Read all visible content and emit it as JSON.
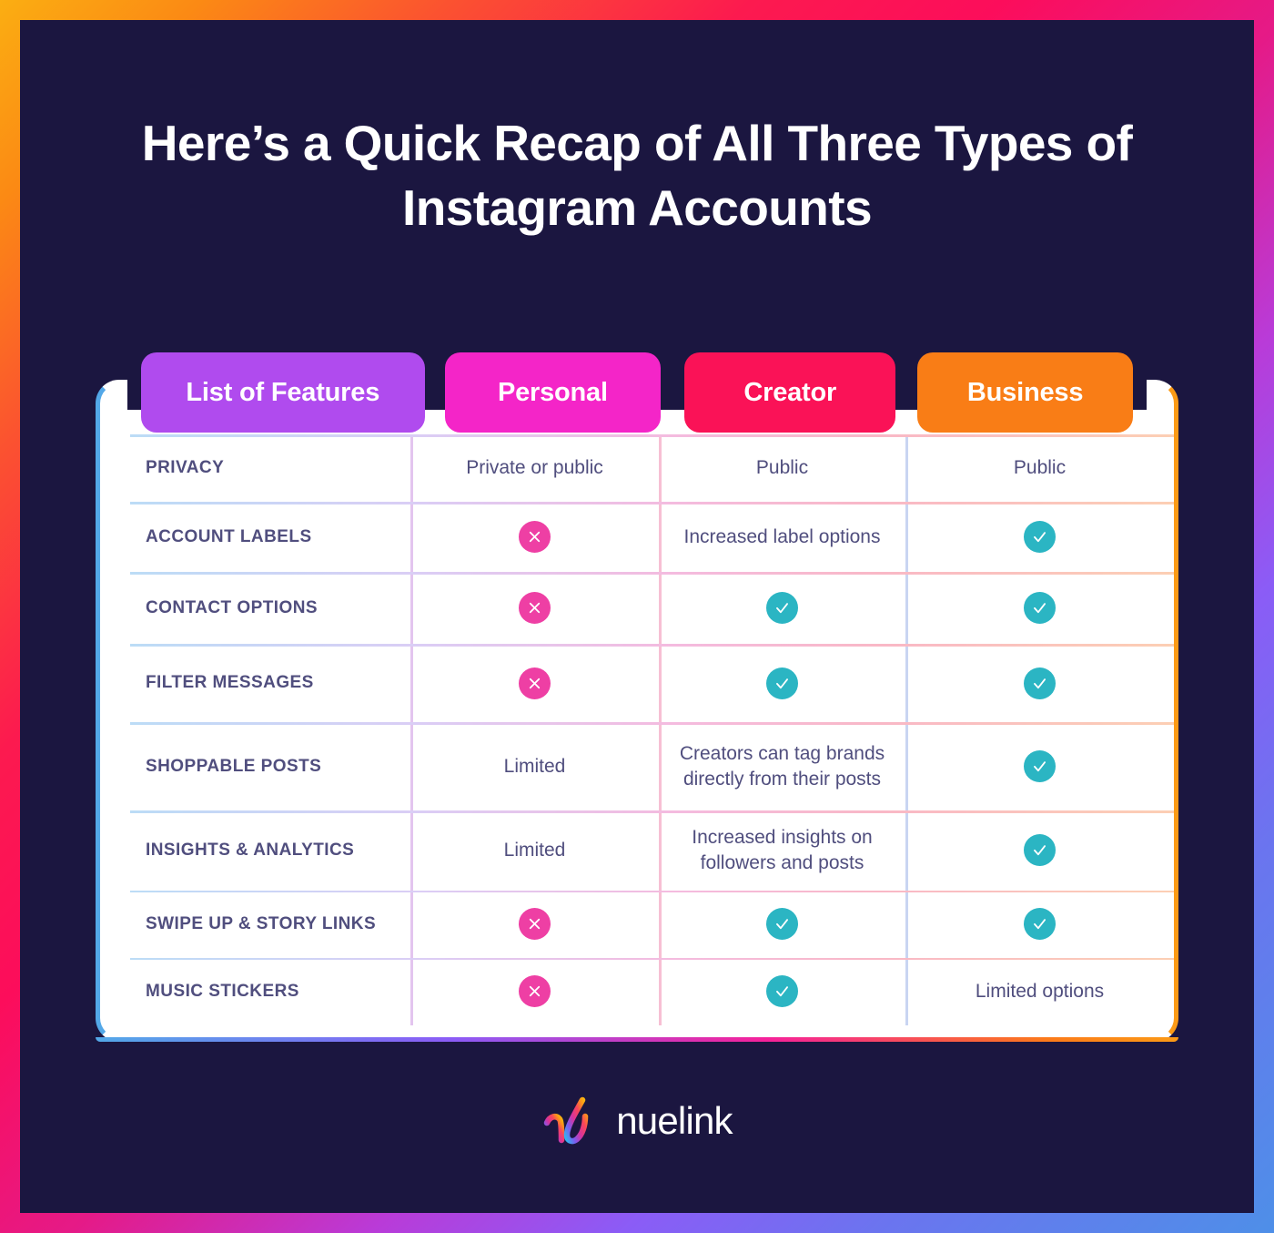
{
  "title": "Here’s a Quick Recap of All Three Types of Instagram Accounts",
  "brand": {
    "wordmark": "nuelink",
    "colors": {
      "background": "#1b1640",
      "frame_start": "#fbae12",
      "frame_mid": "#fc0d5b",
      "frame_end": "#4e8fe8",
      "cross": "#ee3fa4",
      "check": "#2bb5c3",
      "text": "#504e7e"
    }
  },
  "table": {
    "columns": [
      {
        "label": "List of Features",
        "color": "#b04bee"
      },
      {
        "label": "Personal",
        "color": "#f425c8"
      },
      {
        "label": "Creator",
        "color": "#fa1257"
      },
      {
        "label": "Business",
        "color": "#f97d16"
      }
    ],
    "rows": [
      {
        "feature": "PRIVACY",
        "personal": {
          "type": "text",
          "value": "Private or public"
        },
        "creator": {
          "type": "text",
          "value": "Public"
        },
        "business": {
          "type": "text",
          "value": "Public"
        }
      },
      {
        "feature": "ACCOUNT LABELS",
        "personal": {
          "type": "cross",
          "value": "Not available"
        },
        "creator": {
          "type": "text",
          "value": "Increased label options"
        },
        "business": {
          "type": "check",
          "value": "Available"
        }
      },
      {
        "feature": "CONTACT OPTIONS",
        "personal": {
          "type": "cross",
          "value": "Not available"
        },
        "creator": {
          "type": "check",
          "value": "Available"
        },
        "business": {
          "type": "check",
          "value": "Available"
        }
      },
      {
        "feature": "FILTER MESSAGES",
        "personal": {
          "type": "cross",
          "value": "Not available"
        },
        "creator": {
          "type": "check",
          "value": "Available"
        },
        "business": {
          "type": "check",
          "value": "Available"
        }
      },
      {
        "feature": "SHOPPABLE POSTS",
        "personal": {
          "type": "text",
          "value": "Limited"
        },
        "creator": {
          "type": "text",
          "value": "Creators can tag brands directly from their posts"
        },
        "business": {
          "type": "check",
          "value": "Available"
        }
      },
      {
        "feature": "INSIGHTS & ANALYTICS",
        "personal": {
          "type": "text",
          "value": "Limited"
        },
        "creator": {
          "type": "text",
          "value": "Increased insights on followers and posts"
        },
        "business": {
          "type": "check",
          "value": "Available"
        }
      },
      {
        "feature": "SWIPE UP & STORY LINKS",
        "personal": {
          "type": "cross",
          "value": "Not available"
        },
        "creator": {
          "type": "check",
          "value": "Available"
        },
        "business": {
          "type": "check",
          "value": "Available"
        }
      },
      {
        "feature": "MUSIC STICKERS",
        "personal": {
          "type": "cross",
          "value": "Not available"
        },
        "creator": {
          "type": "check",
          "value": "Available"
        },
        "business": {
          "type": "text",
          "value": "Limited options"
        }
      }
    ]
  }
}
